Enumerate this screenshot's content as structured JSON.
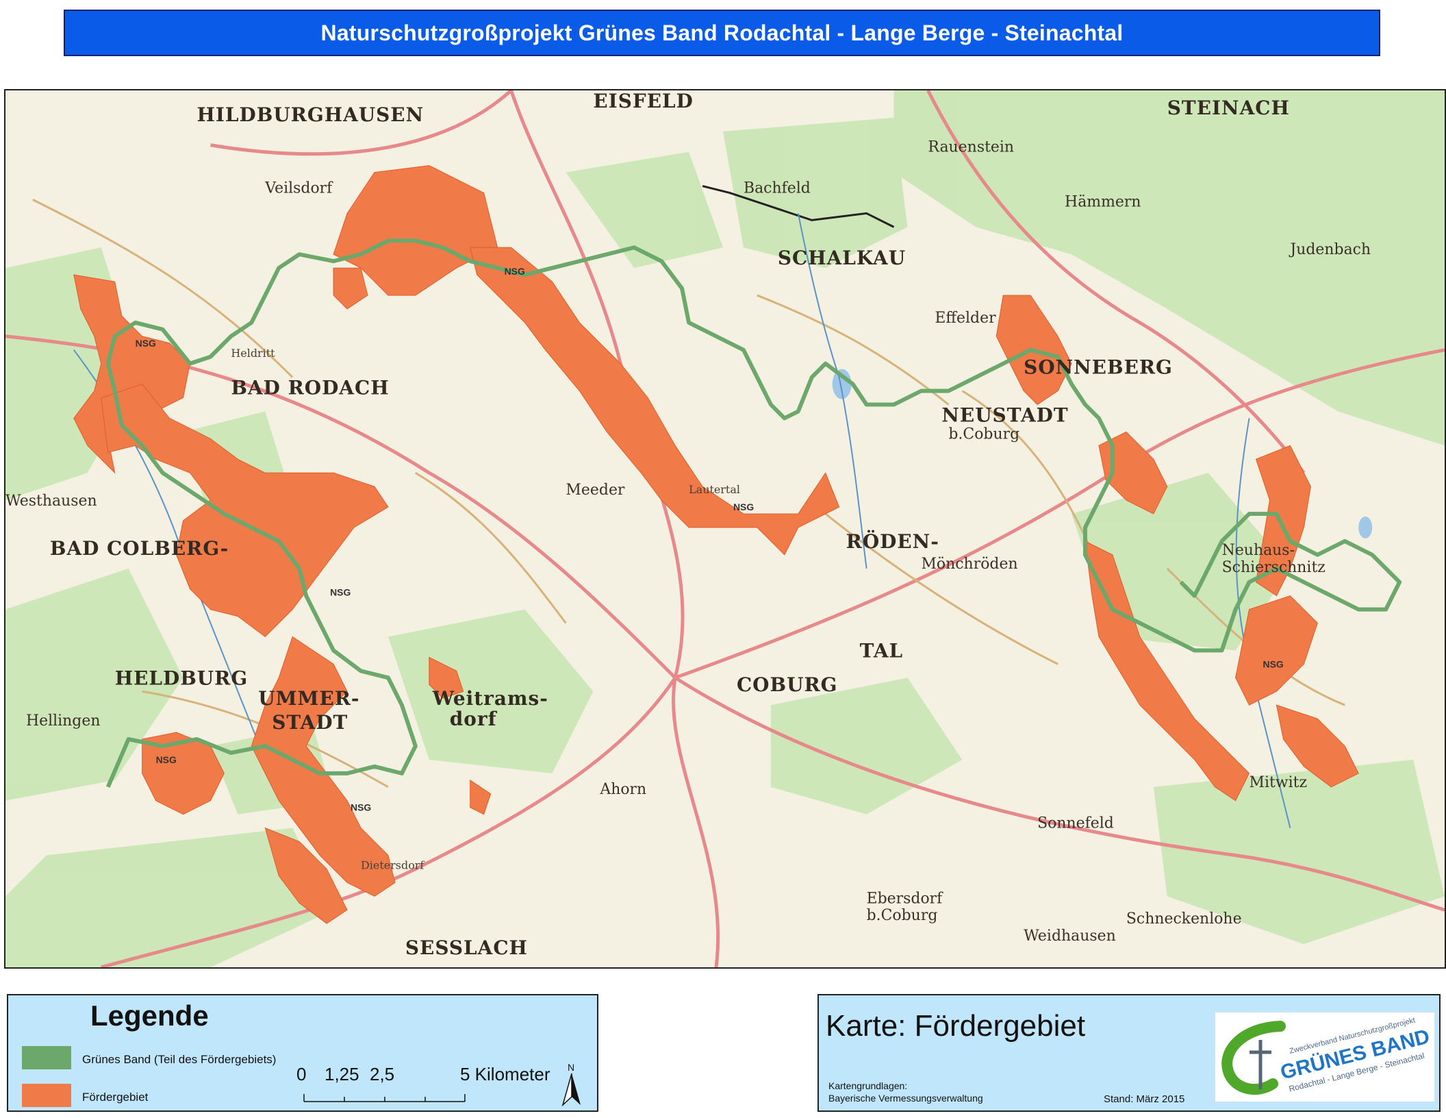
{
  "title": "Naturschutzgroßprojekt Grünes Band Rodachtal - Lange Berge - Steinachtal",
  "colors": {
    "title_bar": "#0a5ce8",
    "gruenes_band": "#6ca86c",
    "foerdergebiet": "#f07a48",
    "panel_background": "#bfe6fa",
    "forest": "#c9e5b4",
    "roads": "#e7898a"
  },
  "map": {
    "places": {
      "hildburghausen": "HILDBURGHAUSEN",
      "eisfeld": "EISFELD",
      "steinach": "STEINACH",
      "veilsdorf": "Veilsdorf",
      "bachfeld": "Bachfeld",
      "rauenstein": "Rauenstein",
      "haemmern": "Hämmern",
      "schalkau": "SCHALKAU",
      "bad_rodach": "BAD RODACH",
      "sonneberg": "SONNEBERG",
      "neustadt": "NEUSTADT",
      "neustadt_sub": "b.Coburg",
      "judenbach": "Judenbach",
      "roedental": "RÖDEN-",
      "roedental_sub": "TAL",
      "bad_colberg": "BAD COLBERG-",
      "heldburg": "HELDBURG",
      "ummerstadt": "UMMER-",
      "ummerstadt_sub": "STADT",
      "coburg": "COBURG",
      "weitramsdorf": "Weitrams-",
      "weitramsdorf_sub": "dorf",
      "sesslach": "SESSLACH",
      "sonnefeld": "Sonnefeld",
      "mitwitz": "Mitwitz",
      "ebersdorf": "Ebersdorf",
      "ebersdorf_sub": "b.Coburg",
      "schneckenlohe": "Schneckenlohe",
      "neuhaus_schierschnitz": "Neuhaus-",
      "neuhaus_schierschnitz_sub": "Schierschnitz",
      "meeder": "Meeder",
      "moenchroeden": "Mönchröden",
      "effelder": "Effelder",
      "heldritt": "Heldritt",
      "weidhausen": "Weidhausen",
      "ahorn": "Ahorn",
      "lautertal": "Lautertal",
      "westhausen": "Westhausen",
      "hellingen": "Hellingen",
      "dietersdorf": "Dietersdorf"
    },
    "nsg_labels": [
      "NSG",
      "NSG",
      "NSG",
      "NSG",
      "NSG",
      "NSG",
      "NSG"
    ]
  },
  "legend": {
    "title": "Legende",
    "items": [
      {
        "label": "Grünes Band (Teil des Fördergebiets)",
        "color": "#6ca86c"
      },
      {
        "label": "Fördergebiet",
        "color": "#f07a48"
      }
    ],
    "scale": {
      "ticks": [
        "0",
        "1,25",
        "2,5"
      ],
      "end_label": "5 Kilometer",
      "values_km": [
        0,
        1.25,
        2.5,
        3.75,
        5
      ]
    },
    "north": "N"
  },
  "info": {
    "title": "Karte: Fördergebiet",
    "source_label": "Kartengrundlagen:",
    "source": "Bayerische Vermessungsverwaltung",
    "date": "Stand: März 2015",
    "logo": {
      "top_text": "Zweckverband Naturschutzgroßprojekt",
      "main_text": "GRÜNES BAND",
      "sub_text": "Rodachtal - Lange Berge - Steinachtal"
    }
  }
}
